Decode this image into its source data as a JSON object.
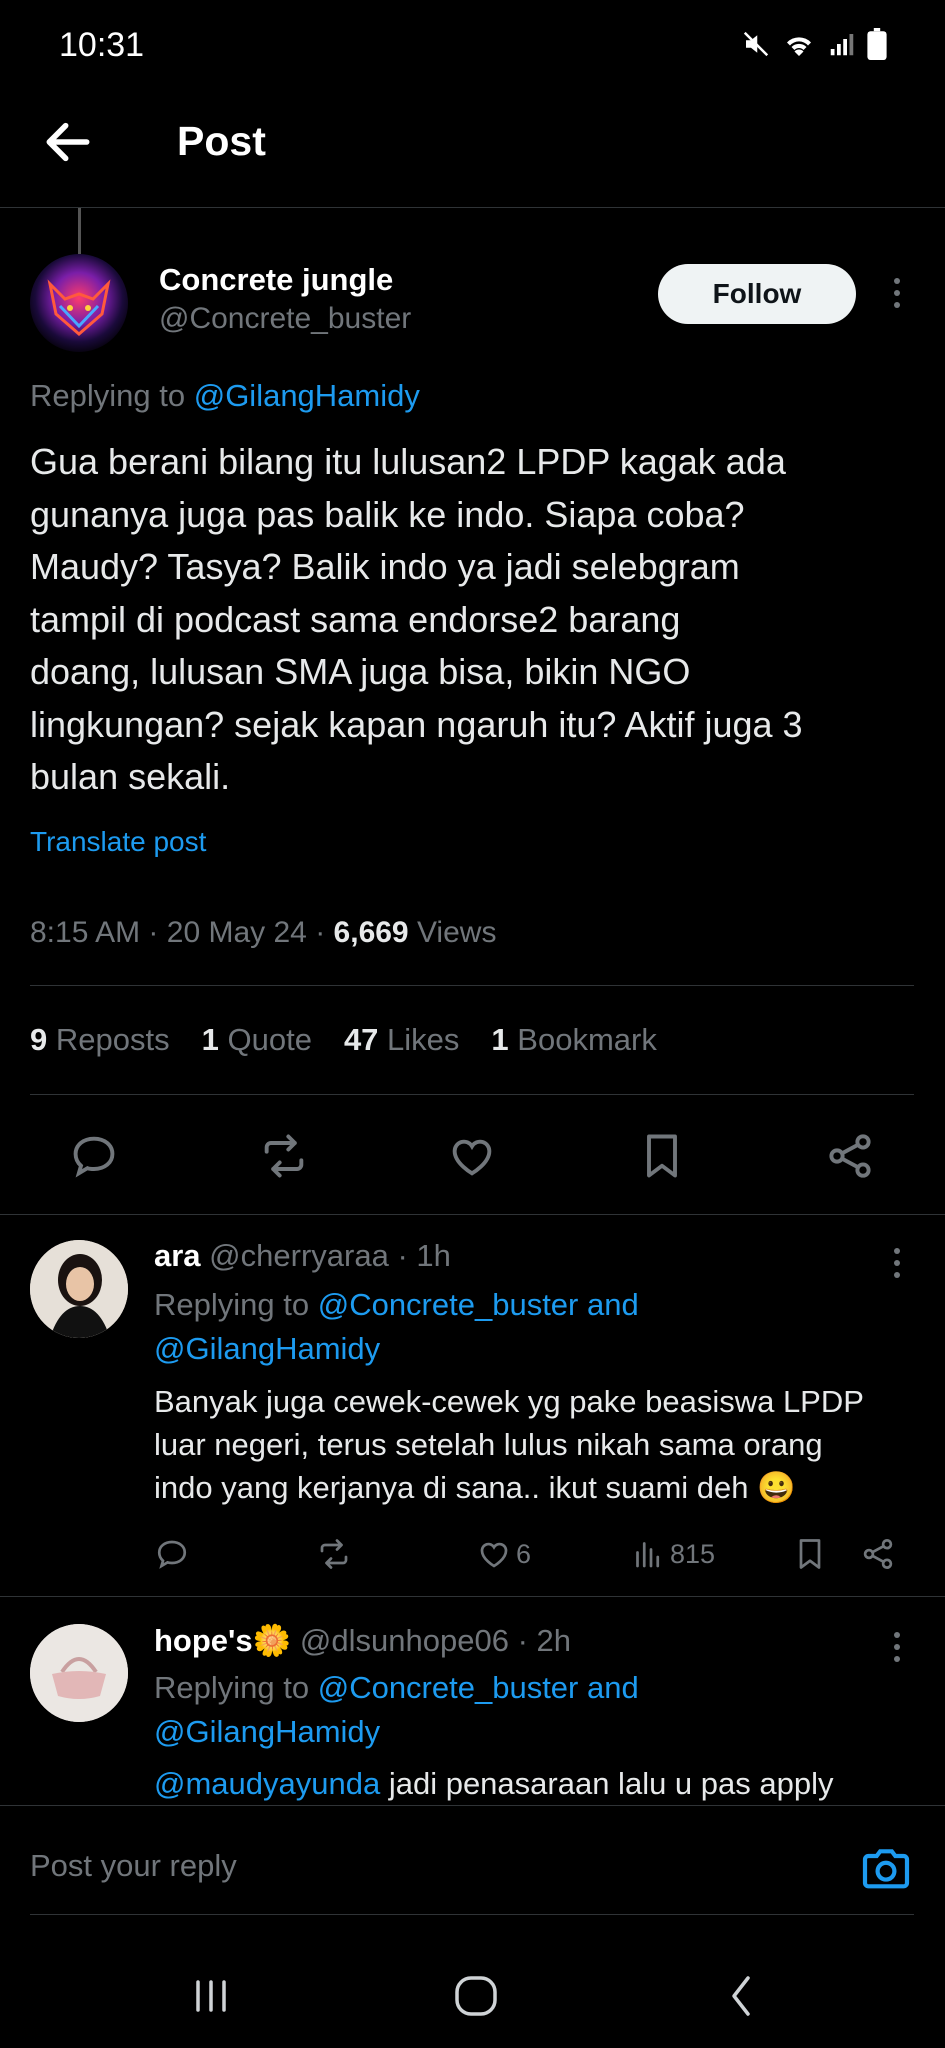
{
  "status_bar": {
    "time": "10:31"
  },
  "header": {
    "title": "Post"
  },
  "tweet": {
    "author_name": "Concrete jungle",
    "author_handle": "@Concrete_buster",
    "follow_label": "Follow",
    "replying_prefix": "Replying to",
    "replying_to": "@GilangHamidy",
    "lines": [
      "Gua berani bilang itu lulusan2 LPDP kagak ada",
      "gunanya juga pas balik ke indo. Siapa coba?",
      "Maudy? Tasya? Balik indo ya jadi selebgram",
      "tampil di podcast sama endorse2 barang",
      "doang, lulusan SMA juga bisa, bikin NGO",
      "lingkungan? sejak kapan ngaruh itu? Aktif juga 3",
      "bulan sekali."
    ],
    "translate_label": "Translate post",
    "time": "8:15 AM",
    "date": "20 May 24",
    "views_count": "6,669",
    "views_label": "Views",
    "reposts_count": "9",
    "reposts_label": "Reposts",
    "quotes_count": "1",
    "quotes_label": "Quote",
    "likes_count": "47",
    "likes_label": "Likes",
    "bookmarks_count": "1",
    "bookmarks_label": "Bookmark",
    "dot": "·"
  },
  "replies": [
    {
      "name": "ara",
      "handle": "@cherryaraa",
      "age": "1h",
      "replying_prefix": "Replying to",
      "replying_to_1": "@Concrete_buster and",
      "replying_to_2": "@GilangHamidy",
      "lines": [
        "Banyak juga cewek-cewek yg pake beasiswa LPDP",
        "luar negeri, terus setelah lulus nikah sama orang",
        "indo yang kerjanya di sana.. ikut suami deh 😀"
      ],
      "likes": "6",
      "views": "815"
    },
    {
      "name": "hope's",
      "name_emoji": "🌼",
      "handle": "@dlsunhope06",
      "age": "2h",
      "replying_prefix": "Replying to",
      "replying_to_1": "@Concrete_buster and",
      "replying_to_2": "@GilangHamidy",
      "mention": "@maudyayunda",
      "line_rest": " jadi penasaraan lalu u pas apply"
    }
  ],
  "composer": {
    "placeholder": "Post your reply"
  },
  "colors": {
    "accent": "#1d9bf0",
    "muted": "#71767b",
    "background": "#000000"
  }
}
